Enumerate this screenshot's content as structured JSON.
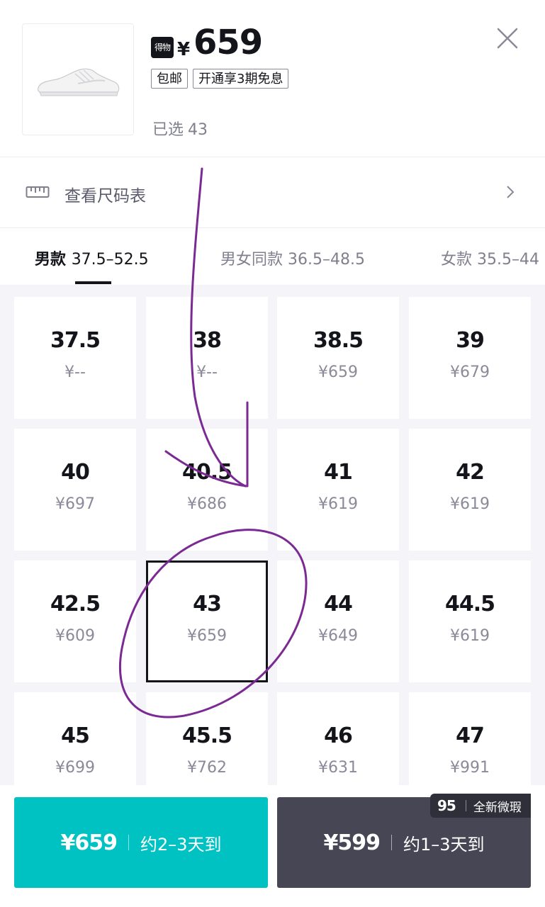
{
  "product": {
    "brand_badge": "得物",
    "currency": "¥",
    "price": "659",
    "tags": [
      "包邮",
      "开通享3期免息"
    ],
    "selected_label": "已选",
    "selected_value": "43"
  },
  "size_chart": {
    "label": "查看尺码表"
  },
  "tabs": [
    {
      "name": "男款",
      "range": "37.5–52.5"
    },
    {
      "name": "男女同款",
      "range": "36.5–48.5"
    },
    {
      "name": "女款",
      "range": "35.5–44"
    }
  ],
  "sizes": [
    {
      "size": "37.5",
      "price": "¥--"
    },
    {
      "size": "38",
      "price": "¥--"
    },
    {
      "size": "38.5",
      "price": "¥659"
    },
    {
      "size": "39",
      "price": "¥679"
    },
    {
      "size": "40",
      "price": "¥697"
    },
    {
      "size": "40.5",
      "price": "¥686"
    },
    {
      "size": "41",
      "price": "¥619"
    },
    {
      "size": "42",
      "price": "¥619"
    },
    {
      "size": "42.5",
      "price": "¥609"
    },
    {
      "size": "43",
      "price": "¥659"
    },
    {
      "size": "44",
      "price": "¥649"
    },
    {
      "size": "44.5",
      "price": "¥619"
    },
    {
      "size": "45",
      "price": "¥699"
    },
    {
      "size": "45.5",
      "price": "¥762"
    },
    {
      "size": "46",
      "price": "¥631"
    },
    {
      "size": "47",
      "price": "¥991"
    }
  ],
  "bottom": {
    "primary": {
      "price": "¥659",
      "delivery": "约2–3天到",
      "color": "#01c2c3"
    },
    "secondary": {
      "price": "¥599",
      "delivery": "约1–3天到",
      "color": "#464655"
    },
    "badge": {
      "logo": "95",
      "label": "全新微瑕"
    }
  },
  "colors": {
    "annotation": "#7b2a93",
    "text_primary": "#14151a",
    "text_secondary": "#8a8a99"
  }
}
